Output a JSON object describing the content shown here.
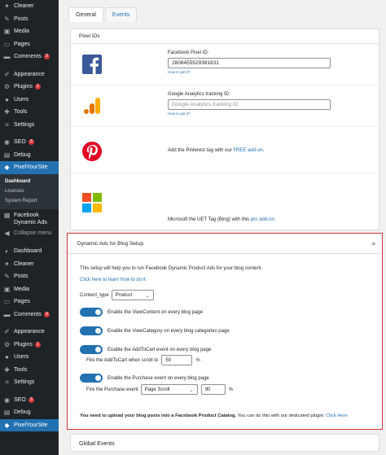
{
  "sidebar": {
    "top_items": [
      {
        "label": "Cleaner",
        "icon": "cleaner-icon",
        "badge": ""
      },
      {
        "label": "Posts",
        "icon": "pin-icon",
        "badge": ""
      },
      {
        "label": "Media",
        "icon": "media-icon",
        "badge": ""
      },
      {
        "label": "Pages",
        "icon": "pages-icon",
        "badge": ""
      },
      {
        "label": "Comments",
        "icon": "comment-icon",
        "badge": "3"
      }
    ],
    "mid_items": [
      {
        "label": "Appearance",
        "icon": "brush-icon",
        "badge": ""
      },
      {
        "label": "Plugins",
        "icon": "plugin-icon",
        "badge": "1"
      },
      {
        "label": "Users",
        "icon": "user-icon",
        "badge": ""
      },
      {
        "label": "Tools",
        "icon": "wrench-icon",
        "badge": ""
      },
      {
        "label": "Settings",
        "icon": "settings-icon",
        "badge": ""
      }
    ],
    "seo": {
      "label": "SEO",
      "badge": "3"
    },
    "debug": {
      "label": "Debug"
    },
    "pys": {
      "label": "PixelYourSite"
    },
    "submenu": [
      "Dashboard",
      "Licenses",
      "System Report"
    ],
    "fb_dynamic_ads": "Facebook Dynamic Ads",
    "collapse": "Collapse menu",
    "bottom_items": [
      {
        "label": "Dashboard",
        "icon": "dashboard-icon",
        "badge": ""
      },
      {
        "label": "Cleaner",
        "icon": "cleaner-icon",
        "badge": ""
      },
      {
        "label": "Posts",
        "icon": "pin-icon",
        "badge": ""
      },
      {
        "label": "Media",
        "icon": "media-icon",
        "badge": ""
      },
      {
        "label": "Pages",
        "icon": "pages-icon",
        "badge": ""
      },
      {
        "label": "Comments",
        "icon": "comment-icon",
        "badge": "3"
      }
    ],
    "bottom_mid_items": [
      {
        "label": "Appearance",
        "icon": "brush-icon",
        "badge": ""
      },
      {
        "label": "Plugins",
        "icon": "plugin-icon",
        "badge": "1"
      },
      {
        "label": "Users",
        "icon": "user-icon",
        "badge": ""
      },
      {
        "label": "Tools",
        "icon": "wrench-icon",
        "badge": ""
      },
      {
        "label": "Settings",
        "icon": "settings-icon",
        "badge": ""
      }
    ],
    "bottom_seo": {
      "label": "SEO",
      "badge": "3"
    },
    "bottom_debug": {
      "label": "Debug"
    },
    "bottom_pys": {
      "label": "PixelYourSite"
    }
  },
  "tabs": [
    {
      "label": "General",
      "active": true
    },
    {
      "label": "Events",
      "active": false
    }
  ],
  "pixel_ids": {
    "title": "Pixel IDs",
    "facebook": {
      "label": "Facebook Pixel ID:",
      "value": "2808455529381831",
      "help": "How to get it?"
    },
    "google": {
      "label": "Google Analytics tracking ID:",
      "placeholder": "Google Analytics tracking ID",
      "help": "How to get it?"
    },
    "pinterest": {
      "text": "Add the Pinterest tag with our ",
      "link": "FREE add-on",
      "suffix": "."
    },
    "microsoft": {
      "text": "Microsoft the UET Tag (Bing) with this ",
      "link": "pro add-on",
      "suffix": "."
    }
  },
  "dpa": {
    "title": "Dynamic Ads for Blog Setup",
    "intro": "This setup will help you to run Facebook Dynamic Product Ads for your blog content.",
    "learn_link": "Click here to learn how to do it",
    "content_type_label": "Content_type",
    "content_type_value": "Product",
    "toggles": [
      "Enable the ViewContent on every blog page",
      "Enable the ViewCategory on every blog categories page",
      "Enable the AddToCart event on every blog page",
      "Enable the Purchase event on every blog page"
    ],
    "addtocart_fire_label": "Fire the AddToCart when scroll to",
    "addtocart_value": "50",
    "percent": "%",
    "purchase_fire_label": "Fire the Purchase event",
    "purchase_select": "Page Scroll",
    "purchase_value": "90",
    "footer_bold": "You need to upload your blog posts into a Facebook Product Catalog.",
    "footer_text": " You can do this with our dedicated plugin: ",
    "footer_link": "Click Here"
  },
  "global_events": {
    "title": "Global Events"
  }
}
